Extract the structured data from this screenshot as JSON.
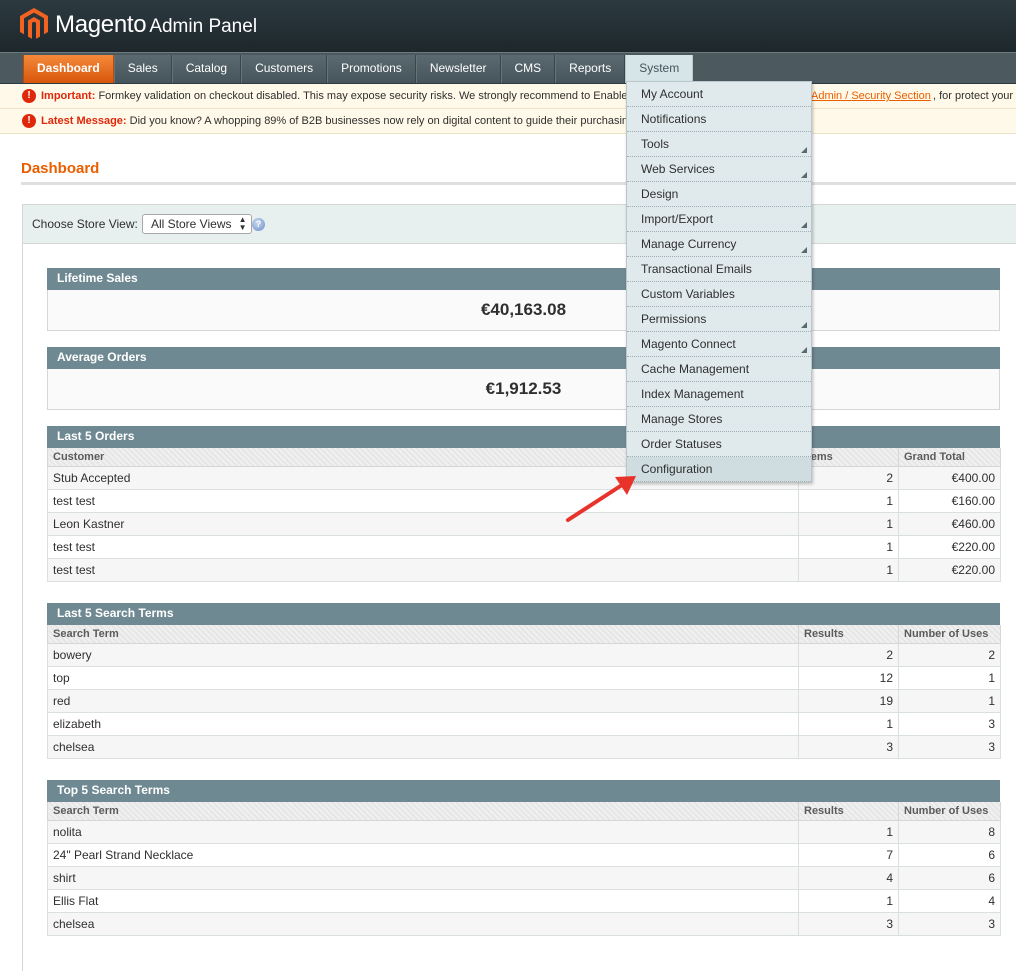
{
  "header": {
    "brand": "Magento",
    "brand_sub": "Admin Panel"
  },
  "nav": {
    "items": [
      {
        "label": "Dashboard",
        "state": "active"
      },
      {
        "label": "Sales"
      },
      {
        "label": "Catalog"
      },
      {
        "label": "Customers"
      },
      {
        "label": "Promotions"
      },
      {
        "label": "Newsletter"
      },
      {
        "label": "CMS"
      },
      {
        "label": "Reports"
      },
      {
        "label": "System",
        "state": "open"
      }
    ]
  },
  "messages": {
    "important_label": "Important:",
    "important_text": "Formkey validation on checkout disabled. This may expose security risks. We strongly recommend to Enable",
    "important_link": "Admin / Security Section",
    "important_after": ", for protect your c",
    "latest_label": "Latest Message:",
    "latest_text": "Did you know? A whopping 89% of B2B businesses now rely on digital content to guide their purchasin"
  },
  "page": {
    "title": "Dashboard"
  },
  "store_switcher": {
    "label": "Choose Store View:",
    "selected": "All Store Views",
    "help_glyph": "?"
  },
  "lifetime_sales": {
    "title": "Lifetime Sales",
    "value": "€40,163.08"
  },
  "average_orders": {
    "title": "Average Orders",
    "value": "€1,912.53"
  },
  "last_orders": {
    "title": "Last 5 Orders",
    "headers": [
      "Customer",
      "Items",
      "Grand Total"
    ],
    "rows": [
      [
        "Stub Accepted",
        "2",
        "€400.00"
      ],
      [
        "test test",
        "1",
        "€160.00"
      ],
      [
        "Leon Kastner",
        "1",
        "€460.00"
      ],
      [
        "test test",
        "1",
        "€220.00"
      ],
      [
        "test test",
        "1",
        "€220.00"
      ]
    ]
  },
  "last_search": {
    "title": "Last 5 Search Terms",
    "headers": [
      "Search Term",
      "Results",
      "Number of Uses"
    ],
    "rows": [
      [
        "bowery",
        "2",
        "2"
      ],
      [
        "top",
        "12",
        "1"
      ],
      [
        "red",
        "19",
        "1"
      ],
      [
        "elizabeth",
        "1",
        "3"
      ],
      [
        "chelsea",
        "3",
        "3"
      ]
    ]
  },
  "top_search": {
    "title": "Top 5 Search Terms",
    "headers": [
      "Search Term",
      "Results",
      "Number of Uses"
    ],
    "rows": [
      [
        "nolita",
        "1",
        "8"
      ],
      [
        "24\" Pearl Strand Necklace",
        "7",
        "6"
      ],
      [
        "shirt",
        "4",
        "6"
      ],
      [
        "Ellis Flat",
        "1",
        "4"
      ],
      [
        "chelsea",
        "3",
        "3"
      ]
    ]
  },
  "system_menu": {
    "items": [
      {
        "label": "My Account",
        "submenu": false
      },
      {
        "label": "Notifications",
        "submenu": false
      },
      {
        "label": "Tools",
        "submenu": true
      },
      {
        "label": "Web Services",
        "submenu": true
      },
      {
        "label": "Design",
        "submenu": false
      },
      {
        "label": "Import/Export",
        "submenu": true
      },
      {
        "label": "Manage Currency",
        "submenu": true
      },
      {
        "label": "Transactional Emails",
        "submenu": false
      },
      {
        "label": "Custom Variables",
        "submenu": false
      },
      {
        "label": "Permissions",
        "submenu": true
      },
      {
        "label": "Magento Connect",
        "submenu": true
      },
      {
        "label": "Cache Management",
        "submenu": false
      },
      {
        "label": "Index Management",
        "submenu": false
      },
      {
        "label": "Manage Stores",
        "submenu": false
      },
      {
        "label": "Order Statuses",
        "submenu": false
      },
      {
        "label": "Configuration",
        "submenu": false,
        "state": "hover"
      }
    ]
  },
  "colors": {
    "accent": "#eb5e00",
    "alert": "#df280a",
    "box_header": "#6f8992",
    "annotation_arrow": "#e8332a"
  }
}
